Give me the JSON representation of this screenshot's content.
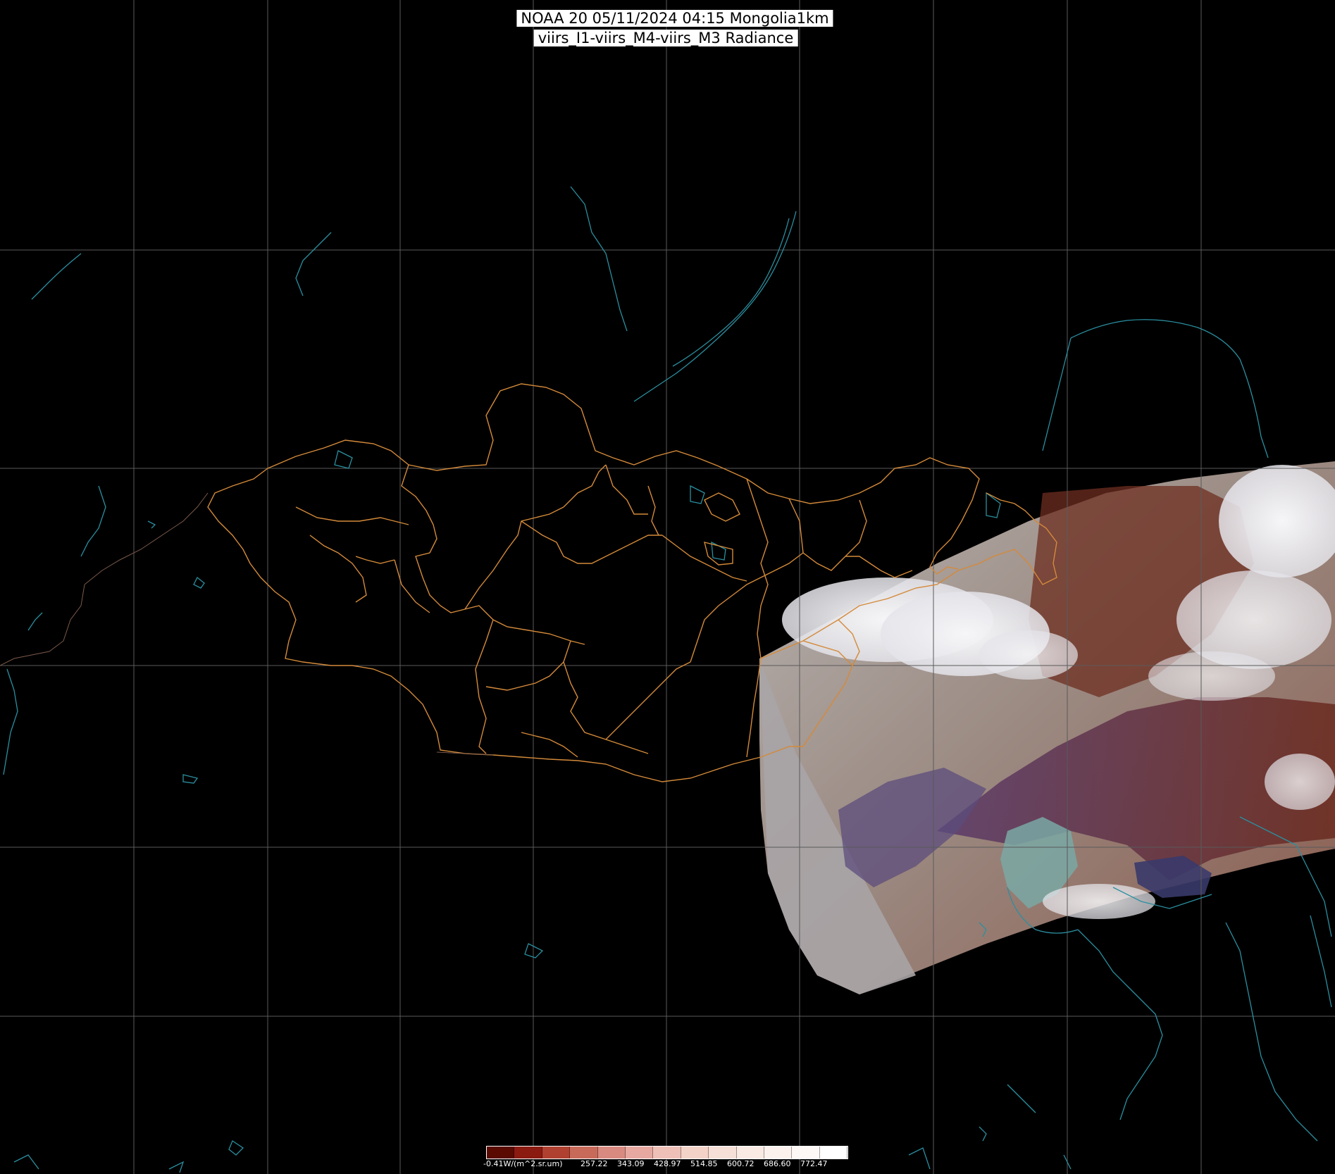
{
  "title": {
    "line1": "NOAA 20 05/11/2024 04:15 Mongolia1km",
    "line2": "viirs_I1-viirs_M4-viirs_M3 Radiance"
  },
  "colorbar": {
    "unit_label": "-0.41W/(m^2.sr.um)",
    "tick_labels": [
      "257.22",
      "343.09",
      "428.97",
      "514.85",
      "600.72",
      "686.60",
      "772.47"
    ],
    "colors": [
      "#5a0a00",
      "#8b1a10",
      "#b04030",
      "#c86a5a",
      "#d88a80",
      "#e6a8a0",
      "#eec0b8",
      "#f3d2c8",
      "#f6dfd6",
      "#f9eae3",
      "#fbf2ee",
      "#fdf8f6",
      "#ffffff"
    ]
  },
  "colors": {
    "background": "#000000",
    "graticule": "#5a5a5a",
    "province_border": "#d48a3a",
    "coastline_lakes": "#2a8fa0",
    "swath_land": "#9a8a80",
    "swath_cloud": "#e8e8ec",
    "swath_mountain": "#6a2e22"
  }
}
